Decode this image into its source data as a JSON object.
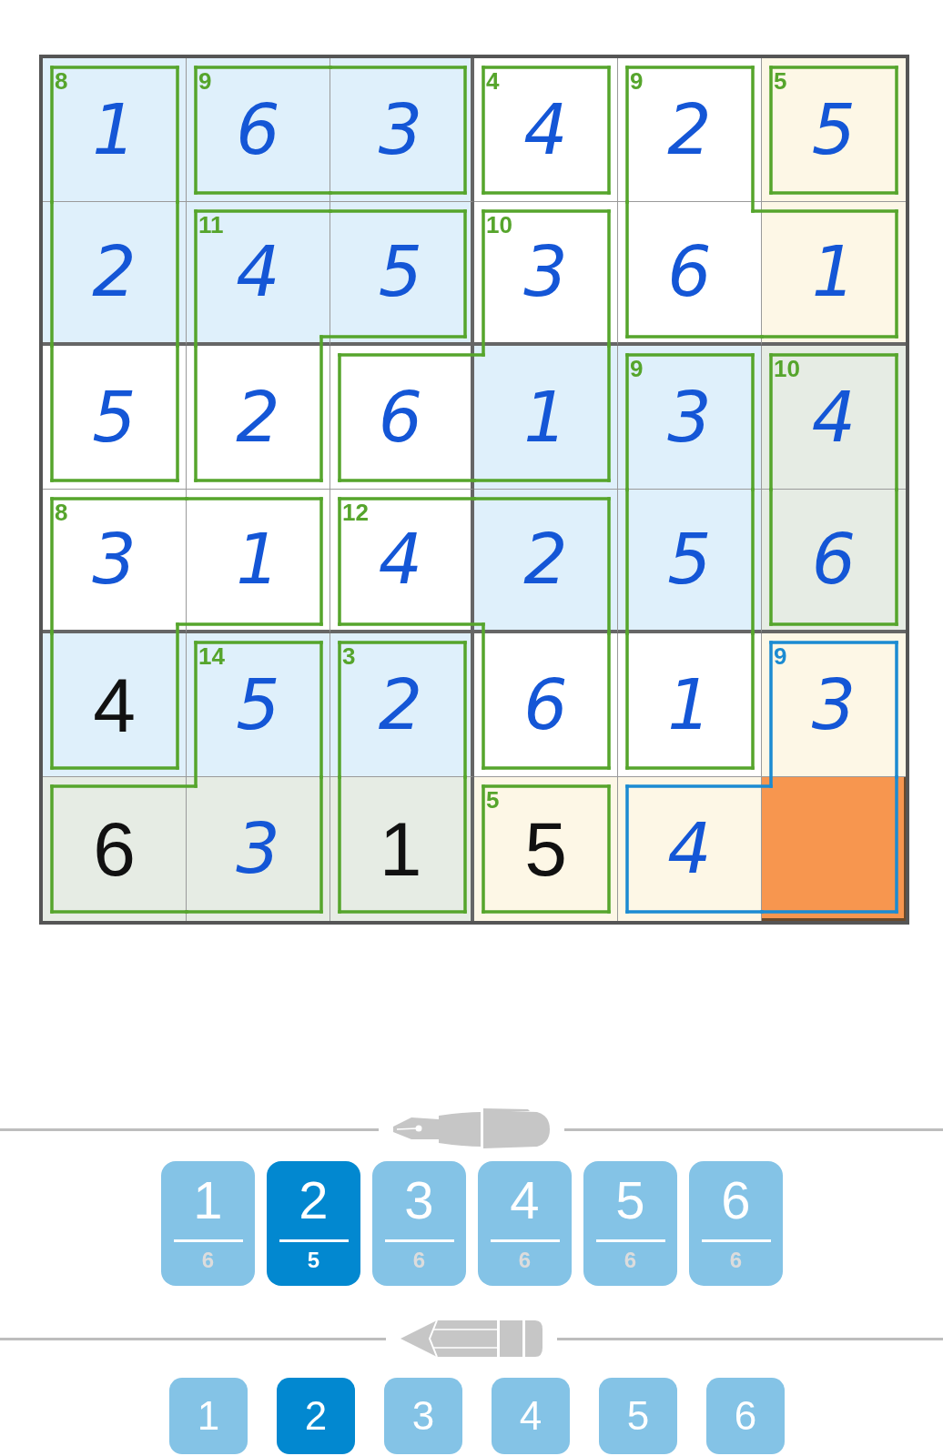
{
  "grid": {
    "rows": [
      {
        "cells": [
          {
            "value": "1",
            "kind": "entered",
            "sum": "8",
            "color": "#dff0fb",
            "selected": false,
            "cage_selected": false,
            "walls": {
              "top": true,
              "right": true,
              "bottom": false,
              "left": true
            }
          },
          {
            "value": "6",
            "kind": "entered",
            "sum": "9",
            "color": "#dff0fb",
            "selected": false,
            "cage_selected": false,
            "walls": {
              "top": true,
              "right": false,
              "bottom": true,
              "left": true
            }
          },
          {
            "value": "3",
            "kind": "entered",
            "color": "#dff0fb",
            "selected": false,
            "cage_selected": false,
            "walls": {
              "top": true,
              "right": true,
              "bottom": true,
              "left": false
            }
          },
          {
            "value": "4",
            "kind": "entered",
            "sum": "4",
            "color": "#ffffff",
            "selected": false,
            "cage_selected": false,
            "walls": {
              "top": true,
              "right": true,
              "bottom": true,
              "left": true
            }
          },
          {
            "value": "2",
            "kind": "entered",
            "sum": "9",
            "color": "#ffffff",
            "selected": false,
            "cage_selected": false,
            "walls": {
              "top": true,
              "right": true,
              "bottom": false,
              "left": true
            }
          },
          {
            "value": "5",
            "kind": "entered",
            "sum": "5",
            "color": "#fdf7e6",
            "selected": false,
            "cage_selected": false,
            "walls": {
              "top": true,
              "right": true,
              "bottom": true,
              "left": true
            }
          }
        ]
      },
      {
        "cells": [
          {
            "value": "2",
            "kind": "entered",
            "color": "#dff0fb",
            "selected": false,
            "cage_selected": false,
            "walls": {
              "top": false,
              "right": true,
              "bottom": false,
              "left": true
            }
          },
          {
            "value": "4",
            "kind": "entered",
            "sum": "11",
            "color": "#dff0fb",
            "selected": false,
            "cage_selected": false,
            "walls": {
              "top": true,
              "right": false,
              "bottom": false,
              "left": true
            }
          },
          {
            "value": "5",
            "kind": "entered",
            "color": "#dff0fb",
            "selected": false,
            "cage_selected": false,
            "walls": {
              "top": true,
              "right": true,
              "bottom": true,
              "left": false
            }
          },
          {
            "value": "3",
            "kind": "entered",
            "sum": "10",
            "color": "#ffffff",
            "selected": false,
            "cage_selected": false,
            "walls": {
              "top": true,
              "right": true,
              "bottom": false,
              "left": true
            }
          },
          {
            "value": "6",
            "kind": "entered",
            "color": "#ffffff",
            "selected": false,
            "cage_selected": false,
            "walls": {
              "top": false,
              "right": false,
              "bottom": true,
              "left": true
            }
          },
          {
            "value": "1",
            "kind": "entered",
            "color": "#fdf7e6",
            "selected": false,
            "cage_selected": false,
            "walls": {
              "top": true,
              "right": true,
              "bottom": true,
              "left": false
            }
          }
        ]
      },
      {
        "cells": [
          {
            "value": "5",
            "kind": "entered",
            "color": "#ffffff",
            "selected": false,
            "cage_selected": false,
            "walls": {
              "top": false,
              "right": true,
              "bottom": true,
              "left": true
            }
          },
          {
            "value": "2",
            "kind": "entered",
            "color": "#ffffff",
            "selected": false,
            "cage_selected": false,
            "walls": {
              "top": false,
              "right": true,
              "bottom": true,
              "left": true
            }
          },
          {
            "value": "6",
            "kind": "entered",
            "color": "#ffffff",
            "selected": false,
            "cage_selected": false,
            "walls": {
              "top": true,
              "right": false,
              "bottom": true,
              "left": true
            }
          },
          {
            "value": "1",
            "kind": "entered",
            "color": "#dff0fb",
            "selected": false,
            "cage_selected": false,
            "walls": {
              "top": false,
              "right": true,
              "bottom": true,
              "left": false
            }
          },
          {
            "value": "3",
            "kind": "entered",
            "sum": "9",
            "color": "#dff0fb",
            "selected": false,
            "cage_selected": false,
            "walls": {
              "top": true,
              "right": true,
              "bottom": false,
              "left": true
            }
          },
          {
            "value": "4",
            "kind": "entered",
            "sum": "10",
            "color": "#e6ece4",
            "selected": false,
            "cage_selected": false,
            "walls": {
              "top": true,
              "right": true,
              "bottom": false,
              "left": true
            }
          }
        ]
      },
      {
        "cells": [
          {
            "value": "3",
            "kind": "entered",
            "sum": "8",
            "color": "#ffffff",
            "selected": false,
            "cage_selected": false,
            "walls": {
              "top": true,
              "right": false,
              "bottom": false,
              "left": true
            }
          },
          {
            "value": "1",
            "kind": "entered",
            "color": "#ffffff",
            "selected": false,
            "cage_selected": false,
            "walls": {
              "top": true,
              "right": true,
              "bottom": true,
              "left": false
            }
          },
          {
            "value": "4",
            "kind": "entered",
            "sum": "12",
            "color": "#ffffff",
            "selected": false,
            "cage_selected": false,
            "walls": {
              "top": true,
              "right": false,
              "bottom": true,
              "left": true
            }
          },
          {
            "value": "2",
            "kind": "entered",
            "color": "#dff0fb",
            "selected": false,
            "cage_selected": false,
            "walls": {
              "top": true,
              "right": true,
              "bottom": false,
              "left": false
            }
          },
          {
            "value": "5",
            "kind": "entered",
            "color": "#dff0fb",
            "selected": false,
            "cage_selected": false,
            "walls": {
              "top": false,
              "right": true,
              "bottom": false,
              "left": true
            }
          },
          {
            "value": "6",
            "kind": "entered",
            "color": "#e6ece4",
            "selected": false,
            "cage_selected": false,
            "walls": {
              "top": false,
              "right": true,
              "bottom": true,
              "left": true
            }
          }
        ]
      },
      {
        "cells": [
          {
            "value": "4",
            "kind": "given",
            "color": "#dff0fb",
            "selected": false,
            "cage_selected": false,
            "walls": {
              "top": false,
              "right": true,
              "bottom": true,
              "left": true
            }
          },
          {
            "value": "5",
            "kind": "entered",
            "sum": "14",
            "color": "#dff0fb",
            "selected": false,
            "cage_selected": false,
            "walls": {
              "top": true,
              "right": true,
              "bottom": false,
              "left": true
            }
          },
          {
            "value": "2",
            "kind": "entered",
            "sum": "3",
            "color": "#dff0fb",
            "selected": false,
            "cage_selected": false,
            "walls": {
              "top": true,
              "right": true,
              "bottom": false,
              "left": true
            }
          },
          {
            "value": "6",
            "kind": "entered",
            "color": "#ffffff",
            "selected": false,
            "cage_selected": false,
            "walls": {
              "top": false,
              "right": true,
              "bottom": true,
              "left": true
            }
          },
          {
            "value": "1",
            "kind": "entered",
            "color": "#ffffff",
            "selected": false,
            "cage_selected": false,
            "walls": {
              "top": false,
              "right": true,
              "bottom": true,
              "left": true
            }
          },
          {
            "value": "3",
            "kind": "entered",
            "sum": "9",
            "color": "#fdf7e6",
            "selected": false,
            "cage_selected": true,
            "walls": {
              "top": true,
              "right": true,
              "bottom": false,
              "left": true
            }
          }
        ]
      },
      {
        "cells": [
          {
            "value": "6",
            "kind": "given",
            "color": "#e6ece4",
            "selected": false,
            "cage_selected": false,
            "walls": {
              "top": true,
              "right": false,
              "bottom": true,
              "left": true
            }
          },
          {
            "value": "3",
            "kind": "entered",
            "color": "#e6ece4",
            "selected": false,
            "cage_selected": false,
            "walls": {
              "top": false,
              "right": true,
              "bottom": true,
              "left": false
            }
          },
          {
            "value": "1",
            "kind": "given",
            "color": "#e6ece4",
            "selected": false,
            "cage_selected": false,
            "walls": {
              "top": false,
              "right": true,
              "bottom": true,
              "left": true
            }
          },
          {
            "value": "5",
            "kind": "given",
            "sum": "5",
            "color": "#fdf7e6",
            "selected": false,
            "cage_selected": false,
            "walls": {
              "top": true,
              "right": true,
              "bottom": true,
              "left": true
            }
          },
          {
            "value": "4",
            "kind": "entered",
            "color": "#fdf7e6",
            "selected": false,
            "cage_selected": true,
            "walls": {
              "top": true,
              "right": false,
              "bottom": true,
              "left": true
            }
          },
          {
            "color": "#f7964f",
            "selected": true,
            "cage_selected": true,
            "walls": {
              "top": false,
              "right": true,
              "bottom": true,
              "left": false
            }
          }
        ]
      }
    ]
  },
  "pen_buttons": [
    {
      "digit": "1",
      "count": "6",
      "selected": false
    },
    {
      "digit": "2",
      "count": "5",
      "selected": true
    },
    {
      "digit": "3",
      "count": "6",
      "selected": false
    },
    {
      "digit": "4",
      "count": "6",
      "selected": false
    },
    {
      "digit": "5",
      "count": "6",
      "selected": false
    },
    {
      "digit": "6",
      "count": "6",
      "selected": false
    }
  ],
  "pencil_buttons": [
    {
      "digit": "1",
      "selected": false
    },
    {
      "digit": "2",
      "selected": true
    },
    {
      "digit": "3",
      "selected": false
    },
    {
      "digit": "4",
      "selected": false
    },
    {
      "digit": "5",
      "selected": false
    },
    {
      "digit": "6",
      "selected": false
    }
  ]
}
